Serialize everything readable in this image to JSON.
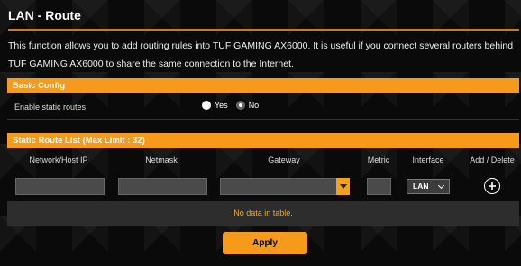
{
  "page": {
    "title": "LAN - Route",
    "description": "This function allows you to add routing rules into TUF GAMING AX6000. It is useful if you connect several routers behind TUF GAMING AX6000 to share the same connection to the Internet."
  },
  "basic_config": {
    "header": "Basic Config",
    "enable_label": "Enable static routes",
    "yes_label": "Yes",
    "no_label": "No",
    "selected": "No"
  },
  "route_list": {
    "header": "Static Route List (Max Limit : 32)",
    "columns": [
      "Network/Host IP",
      "Netmask",
      "Gateway",
      "Metric",
      "Interface",
      "Add / Delete"
    ],
    "inputs": {
      "network_ip": "",
      "netmask": "",
      "gateway": "",
      "metric": "",
      "interface": "LAN"
    },
    "empty_text": "No data in table."
  },
  "actions": {
    "apply_label": "Apply"
  },
  "colors": {
    "accent": "#f59a1b",
    "empty_text": "#f5a623",
    "background": "#0a0a0a"
  },
  "icons": {
    "add": "plus-circle-icon",
    "gateway_dropdown": "triangle-down-icon",
    "interface_dropdown": "chevron-down-icon"
  }
}
